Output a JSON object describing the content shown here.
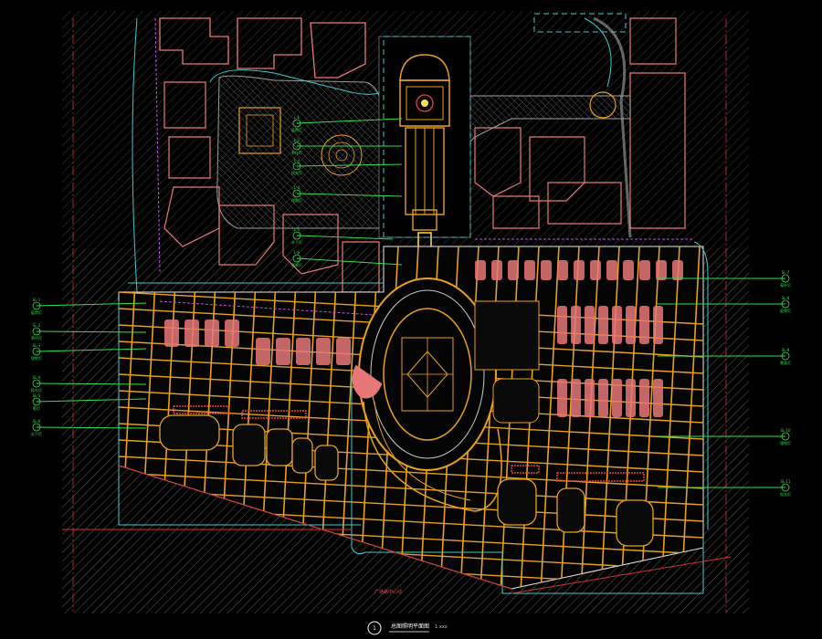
{
  "drawing": {
    "title": "总图照明平面图",
    "scale": "1:xxx",
    "view_number": "1",
    "road_label": "广场路中心线"
  },
  "colors": {
    "background": "#000000",
    "hatch": "#6a6a6a",
    "paving": "#e8a020",
    "building": "#e87878",
    "cyan": "#40c8c8",
    "leader": "#30e050",
    "magenta": "#c050e0",
    "red": "#d83030",
    "white": "#ffffff",
    "yellow": "#ffe040"
  },
  "callouts_left": [
    {
      "tag": "SL-1",
      "desc": "庭院灯"
    },
    {
      "tag": "SL-2",
      "desc": "草坪灯"
    },
    {
      "tag": "SL-3",
      "desc": "埋地灯"
    },
    {
      "tag": "SL-4",
      "desc": "投光灯"
    },
    {
      "tag": "SL-5",
      "desc": "壁灯"
    },
    {
      "tag": "SL-6",
      "desc": "水下灯"
    }
  ],
  "callouts_right": [
    {
      "tag": "SL-7",
      "desc": "高杆灯"
    },
    {
      "tag": "SL-8",
      "desc": "庭院灯"
    },
    {
      "tag": "SL-9",
      "desc": "景观灯"
    },
    {
      "tag": "SL-10",
      "desc": "埋地灯"
    },
    {
      "tag": "SL-11",
      "desc": "投光灯"
    }
  ],
  "callouts_center": [
    {
      "tag": "L-1",
      "desc": "庭院灯"
    },
    {
      "tag": "L-2",
      "desc": "草坪灯"
    },
    {
      "tag": "L-3",
      "desc": "投光灯"
    },
    {
      "tag": "L-4",
      "desc": "埋地灯"
    },
    {
      "tag": "L-5",
      "desc": "水下灯"
    },
    {
      "tag": "L-6",
      "desc": "景观灯"
    }
  ]
}
